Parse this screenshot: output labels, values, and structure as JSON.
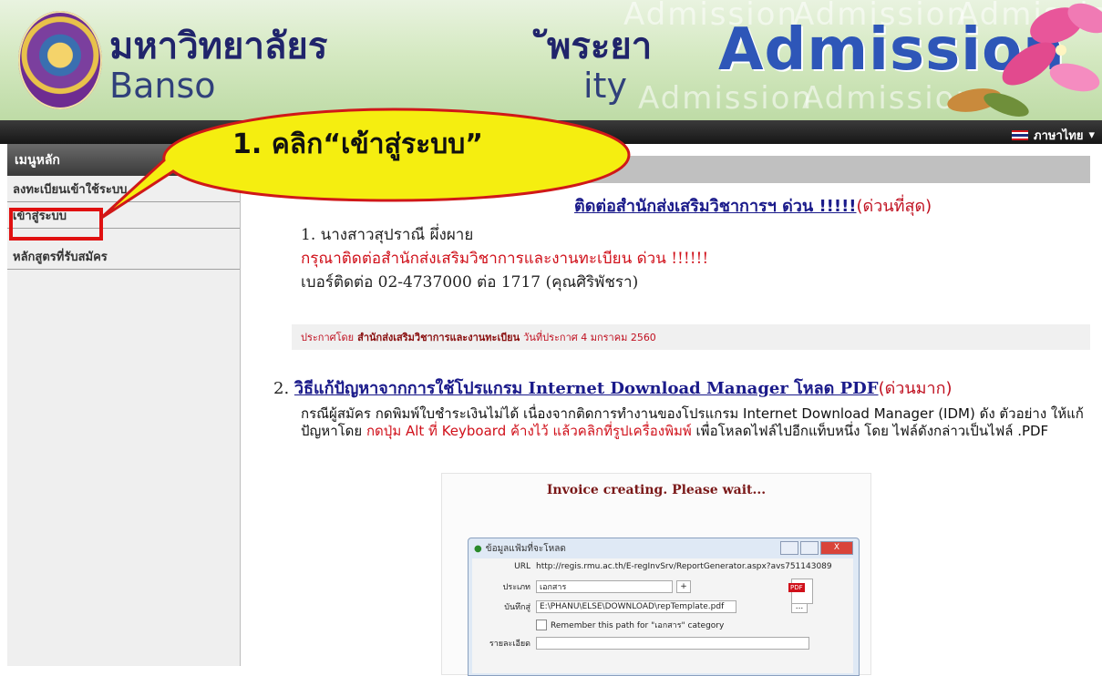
{
  "header": {
    "uni_th": "มหาวิทยาลัยร",
    "uni_th_end": "ัพระยา",
    "uni_en": "Banso",
    "uni_en_end": "ity",
    "title": "Admission",
    "watermark": "Admission"
  },
  "nav": {
    "language": "ภาษาไทย"
  },
  "sidebar": {
    "heading": "เมนูหลัก",
    "items": [
      "ลงทะเบียนเข้าใช้ระบบ",
      "เข้าสู่ระบบ",
      "หลักสูตรที่รับสมัคร"
    ]
  },
  "callout": {
    "text": "1. คลิก“เข้าสู่ระบบ”"
  },
  "news1": {
    "title": "ติดต่อสำนักส่งเสริมวิชาการฯ ด่วน !!!!!",
    "urgency": "(ด่วนที่สุด)",
    "line_name": "1. นางสาวสุปราณี ผึ่งผาย",
    "line_red": "กรุณาติดต่อสำนักส่งเสริมวิชาการและงานทะเบียน ด่วน !!!!!!",
    "line_phone": "เบอร์ติดต่อ 02-4737000 ต่อ 1717 (คุณศิริพัชรา)",
    "meta_prefix": "ประกาศโดย",
    "meta_org": "สำนักส่งเสริมวิชาการและงานทะเบียน",
    "meta_date": "วันที่ประกาศ  4 มกราคม 2560"
  },
  "news2": {
    "number": "2.",
    "title": "วิธีแก้ปัญหาจากการใช้โปรแกรม Internet Download Manager โหลด PDF",
    "urgency": "(ด่วนมาก)",
    "body_1": "กรณีผู้สมัคร กดพิมพ์ใบชำระเงินไม่ได้ เนื่องจากติดการทำงานของโปรแกรม Internet Download Manager (IDM) ดัง ตัวอย่าง ให้แก้ปัญหาโดย ",
    "body_red": "กดปุ่ม Alt ที่ Keyboard ค้างไว้ แล้วคลิกที่รูปเครื่องพิมพ์",
    "body_2": " เพื่อโหลดไฟล์ไปอีกแท็บหนึ่ง โดย ไฟล์ดังกล่าวเป็นไฟล์ .PDF",
    "invoice": "Invoice creating. Please wait...",
    "dialog": {
      "title": "ข้อมูลแฟ้มที่จะโหลด",
      "url_label": "URL",
      "url": "http://regis.rmu.ac.th/E-regInvSrv/ReportGenerator.aspx?avs751143089",
      "type_label": "ประเภท",
      "type_value": "เอกสาร",
      "save_label": "บันทึกสู่",
      "save_path": "E:\\PHANU\\ELSE\\DOWNLOAD\\repTemplate.pdf",
      "remember": "Remember this path for \"เอกสาร\" category",
      "desc_label": "รายละเอียด",
      "browse": "...",
      "plus": "+"
    }
  }
}
